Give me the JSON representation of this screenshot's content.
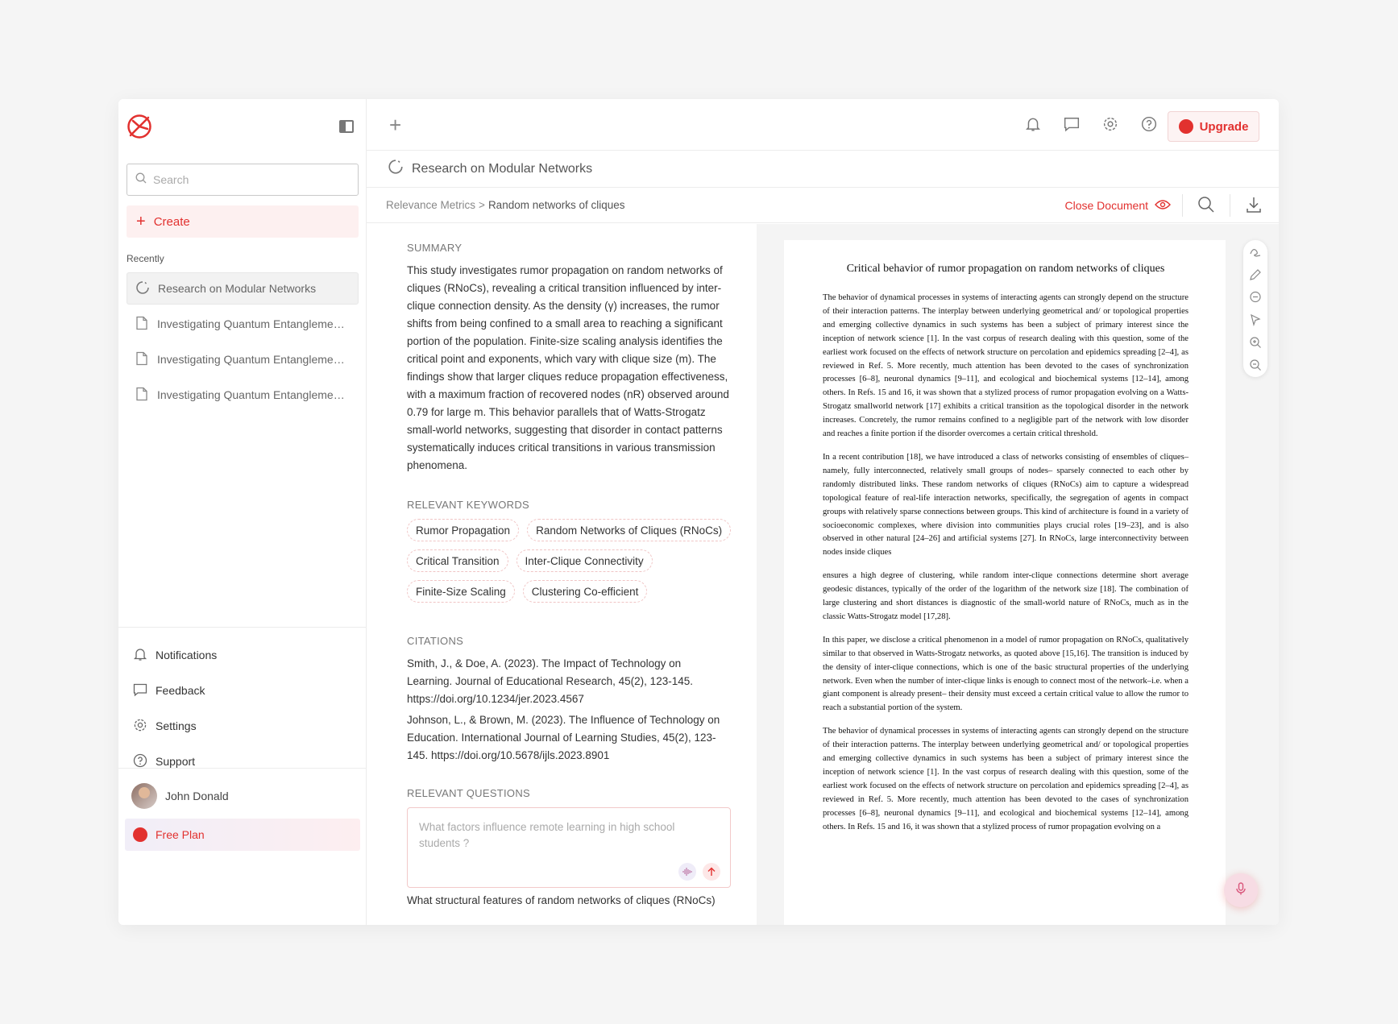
{
  "sidebar": {
    "search_placeholder": "Search",
    "create_label": "Create",
    "recently_label": "Recently",
    "recent_items": [
      {
        "label": "Research on Modular Networks",
        "icon": "loading-circle-icon"
      },
      {
        "label": "Investigating Quantum Entanglement: It...",
        "icon": "document-icon"
      },
      {
        "label": "Investigating Quantum Entanglement: It...",
        "icon": "document-icon"
      },
      {
        "label": "Investigating Quantum Entanglement: It...",
        "icon": "document-icon"
      }
    ],
    "links": [
      {
        "label": "Notifications",
        "icon": "bell-icon"
      },
      {
        "label": "Feedback",
        "icon": "chat-icon"
      },
      {
        "label": "Settings",
        "icon": "gear-icon"
      },
      {
        "label": "Support",
        "icon": "help-icon"
      }
    ],
    "user_name": "John Donald",
    "plan_label": "Free Plan"
  },
  "topbar": {
    "upgrade_label": "Upgrade"
  },
  "document": {
    "title": "Research on Modular Networks",
    "breadcrumb_parent": "Relevance Metrics",
    "breadcrumb_sep": ">",
    "breadcrumb_current": "Random networks of cliques",
    "close_label": "Close Document"
  },
  "panel": {
    "summary_title": "SUMMARY",
    "summary_text": "This study investigates rumor propagation on random networks of cliques (RNoCs), revealing a critical transition influenced by inter-clique connection density. As the density (γ) increases, the rumor shifts from being confined to a small area to reaching a significant portion of the population. Finite-size scaling analysis identifies the critical point and exponents, which vary with clique size (m). The findings show that larger cliques reduce propagation effectiveness, with a maximum fraction of recovered nodes (nR) observed around 0.79 for large m. This behavior parallels that of Watts-Strogatz small-world networks, suggesting that disorder in contact patterns systematically induces critical transitions in various transmission phenomena.",
    "keywords_title": "RELEVANT KEYWORDS",
    "keywords": [
      "Rumor Propagation",
      "Random Networks of Cliques (RNoCs)",
      "Critical Transition",
      "Inter-Clique Connectivity",
      "Finite-Size Scaling",
      "Clustering Co-efficient"
    ],
    "citations_title": "CITATIONS",
    "citations": [
      "Smith, J., & Doe, A. (2023). The Impact of Technology on Learning. Journal of Educational Research, 45(2), 123-145. https://doi.org/10.1234/jer.2023.4567",
      "Johnson, L., & Brown, M. (2023). The Influence of Technology on Education. International Journal of Learning Studies, 45(2), 123-145. https://doi.org/10.5678/ijls.2023.8901"
    ],
    "questions_title": "RELEVANT QUESTIONS",
    "question_placeholder": "What factors influence remote learning in high school students ?",
    "question_next": "What structural features of random networks of cliques (RNoCs)"
  },
  "paper": {
    "title": "Critical behavior of rumor propagation on random networks of cliques",
    "paragraphs": [
      "The behavior of dynamical processes in systems of interacting agents can strongly depend on the structure of their interaction patterns. The interplay between underlying geometrical and/ or topological properties and emerging collective dynamics in such systems has been a subject of primary interest since the inception of network science [1]. In the vast corpus of research dealing with this question, some of the earliest work focused on the effects of network structure on percolation and epidemics spreading [2–4], as reviewed in Ref. 5. More recently, much attention has been devoted to the cases of synchronization processes [6–8], neuronal dynamics [9–11], and ecological and biochemical systems [12–14], among others. In Refs. 15 and 16, it was shown that a stylized process of rumor propagation evolving on a Watts-Strogatz smallworld network [17] exhibits a critical transition as the topological disorder in the network increases. Concretely, the rumor remains confined to a negligible part of the network with low disorder and reaches a finite portion if the disorder overcomes a certain critical threshold.",
      "In a recent contribution [18], we have introduced a class of networks consisting of ensembles of cliques–namely, fully interconnected, relatively small groups of nodes– sparsely connected to each other by randomly distributed links. These random networks of cliques (RNoCs) aim to capture a widespread topological feature of real-life interaction networks, specifically, the segregation of agents in compact groups with relatively sparse connections between groups. This kind of architecture is found in a variety of socioeconomic complexes, where division into communities plays crucial roles [19–23], and is also observed in other natural [24–26] and artificial systems [27]. In RNoCs, large interconnectivity between nodes inside cliques",
      "ensures a high degree of clustering, while random inter-clique connections determine short average geodesic distances, typically of the order of the logarithm of the network size [18]. The combination of large clustering and short distances is diagnostic of the small-world nature of RNoCs, much as in the classic Watts-Strogatz model [17,28].",
      "In this paper, we disclose a critical phenomenon in a model of rumor propagation on RNoCs, qualitatively similar to that observed in Watts-Strogatz networks, as quoted above [15,16]. The transition is induced by the density of inter-clique connections, which is one of the basic structural properties of the underlying network. Even when the number of inter-clique links is enough to connect most of the network–i.e. when a giant component is already present– their density must exceed a certain critical value to allow the rumor to reach a substantial portion of the system.",
      "The behavior of dynamical processes in systems of interacting agents can strongly depend on the structure of their interaction patterns. The interplay between underlying geometrical and/ or topological properties and emerging collective dynamics in such systems has been a subject of primary interest since the inception of network science [1]. In the vast corpus of research dealing with this question, some of the earliest work focused on the effects of network structure on percolation and epidemics spreading [2–4], as reviewed in Ref. 5. More recently, much attention has been devoted to the cases of synchronization processes [6–8], neuronal dynamics [9–11], and ecological and biochemical systems [12–14], among others. In Refs. 15 and 16, it was shown that a stylized process of rumor propagation evolving on a"
    ]
  },
  "colors": {
    "accent": "#e2312f",
    "accent_soft": "#fdf0f0"
  }
}
